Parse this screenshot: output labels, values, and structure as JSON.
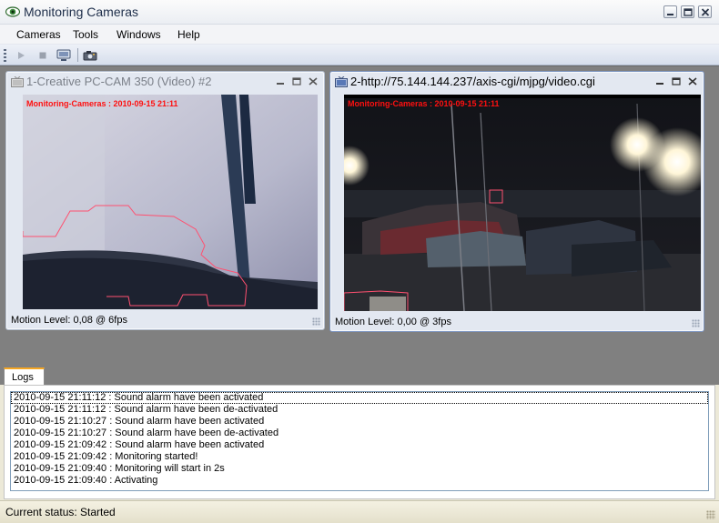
{
  "window": {
    "title": "Monitoring Cameras"
  },
  "menu": [
    "Cameras",
    "Tools",
    "Windows",
    "Help"
  ],
  "toolbar": {
    "icons": [
      "play-icon",
      "stop-icon",
      "camera-settings-icon",
      "snapshot-icon"
    ]
  },
  "cameras": [
    {
      "title": "1-Creative PC-CAM 350 (Video) #2",
      "overlay": "Monitoring-Cameras : 2010-09-15 21:11",
      "status": "Motion Level: 0,08 @ 6fps"
    },
    {
      "title": "2-http://75.144.144.237/axis-cgi/mjpg/video.cgi",
      "overlay": "Monitoring-Cameras : 2010-09-15 21:11",
      "status": "Motion Level: 0,00 @ 3fps"
    }
  ],
  "logs": {
    "tab_label": "Logs",
    "entries": [
      "2010-09-15 21:11:12 : Sound alarm have been activated",
      "2010-09-15 21:11:12 : Sound alarm have been de-activated",
      "2010-09-15 21:10:27 : Sound alarm have been activated",
      "2010-09-15 21:10:27 : Sound alarm have been de-activated",
      "2010-09-15 21:09:42 : Sound alarm have been activated",
      "2010-09-15 21:09:42 : Monitoring started!",
      "2010-09-15 21:09:40 : Monitoring will start in 2s",
      "2010-09-15 21:09:40 : Activating"
    ]
  },
  "status_bar": {
    "text": "Current status: Started"
  },
  "colors": {
    "overlay_text": "#ff1010",
    "motion_zone": "#ff5070",
    "tab_accent": "#f5a623"
  }
}
